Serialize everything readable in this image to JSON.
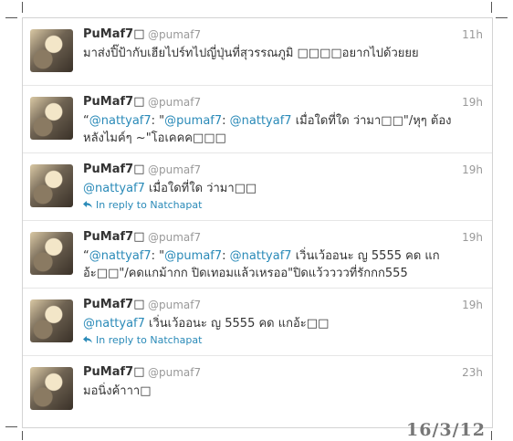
{
  "tweets": [
    {
      "name": "PuMaf7□",
      "handle": "@pumaf7",
      "time": "11h",
      "segments": [
        {
          "text": "มาส่งปิ๊ป้ากับเฮียไปร์ทไปญี่ปุ่นที่สุวรรณภูมิ □□□□อยากไปด้วยยย",
          "mention": false
        }
      ],
      "reply": ""
    },
    {
      "name": "PuMaf7□",
      "handle": "@pumaf7",
      "time": "19h",
      "segments": [
        {
          "text": "“",
          "mention": false
        },
        {
          "text": "@nattyaf7",
          "mention": true
        },
        {
          "text": ": \"",
          "mention": false
        },
        {
          "text": "@pumaf7",
          "mention": true
        },
        {
          "text": ": ",
          "mention": false
        },
        {
          "text": "@nattyaf7",
          "mention": true
        },
        {
          "text": " เมื่อใดที่ใด ว่ามา□□\"/หุๆ ต้องหลังไมค์ๆ ~\"โอเคคค□□□",
          "mention": false
        }
      ],
      "reply": ""
    },
    {
      "name": "PuMaf7□",
      "handle": "@pumaf7",
      "time": "19h",
      "segments": [
        {
          "text": "@nattyaf7",
          "mention": true
        },
        {
          "text": " เมื่อใดที่ใด ว่ามา□□",
          "mention": false
        }
      ],
      "reply": "In reply to Natchapat"
    },
    {
      "name": "PuMaf7□",
      "handle": "@pumaf7",
      "time": "19h",
      "segments": [
        {
          "text": "“",
          "mention": false
        },
        {
          "text": "@nattyaf7",
          "mention": true
        },
        {
          "text": ": \"",
          "mention": false
        },
        {
          "text": "@pumaf7",
          "mention": true
        },
        {
          "text": ": ",
          "mention": false
        },
        {
          "text": "@nattyaf7",
          "mention": true
        },
        {
          "text": " เวิ่นเว้ออนะ ญ 5555 คด แกอ้ะ□□\"/คดแกม้ากก ปิดเทอมแล้วเหรออ\"ปิดแว้ววววที่รักกก555",
          "mention": false
        }
      ],
      "reply": ""
    },
    {
      "name": "PuMaf7□",
      "handle": "@pumaf7",
      "time": "19h",
      "segments": [
        {
          "text": "@nattyaf7",
          "mention": true
        },
        {
          "text": " เวิ่นเว้ออนะ ญ 5555 คด แกอ้ะ□□",
          "mention": false
        }
      ],
      "reply": "In reply to Natchapat"
    },
    {
      "name": "PuMaf7□",
      "handle": "@pumaf7",
      "time": "23h",
      "segments": [
        {
          "text": "มอนิ่งค้าาา□",
          "mention": false
        }
      ],
      "reply": ""
    }
  ],
  "reply_icon": "reply-arrow-icon",
  "date_stamp": "16/3/12",
  "colors": {
    "mention": "#2a8ab8",
    "muted": "#999999",
    "name": "#333333"
  }
}
